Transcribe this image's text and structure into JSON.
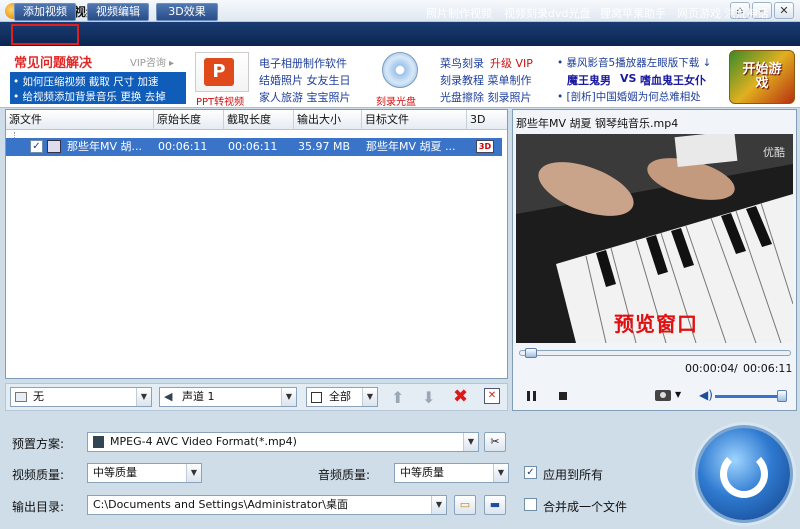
{
  "app": {
    "title": "狸窝全能视频转换器"
  },
  "toolbar": {
    "add_video": "添加视频",
    "edit_video": "视频编辑",
    "effect_3d": "3D效果",
    "links": [
      "照片制作视频",
      "视频刻录dvd光盘",
      "狸窝苹果助手",
      "网页游戏 洪荒神话"
    ]
  },
  "ads": {
    "faq_title": "常见问题解决",
    "vip": "VIP咨询 ▸",
    "faq_items": [
      "• 如何压缩视频  截取  尺寸  加速",
      "• 给视频添加背景音乐  更换  去掉"
    ],
    "ppt_label": "PPT转视频",
    "col1": [
      "电子相册制作软件",
      "结婚照片  女友生日",
      "家人旅游  宝宝照片"
    ],
    "burn_label": "刻录光盘",
    "col2": [
      "菜鸟刻录",
      "升级 VIP",
      "刻录教程  菜单制作",
      "光盘擦除  刻录照片"
    ],
    "col3": [
      "• 暴风影音5播放器左眼版下载 ↓",
      "魔王鬼男",
      "VS",
      "嗜血鬼王女仆",
      "• [剖析]中国婚姻为何总难相处"
    ],
    "game_btn": "开始游戏"
  },
  "file_list": {
    "headers": [
      "源文件",
      "原始长度",
      "截取长度",
      "输出大小",
      "目标文件",
      "3D"
    ],
    "rows": [
      {
        "source": "那些年MV 胡...",
        "orig": "00:06:11",
        "cut": "00:06:11",
        "size": "35.97 MB",
        "target": "那些年MV 胡夏 ..."
      }
    ]
  },
  "list_tools": {
    "subtitle": "无",
    "audio": "声道 1",
    "all": "全部"
  },
  "preview": {
    "title": "那些年MV 胡夏 钢琴纯音乐.mp4",
    "watermark": "预览窗口",
    "youku": "优酷",
    "time_current": "00:00:04",
    "time_separator": "/",
    "time_total": "00:06:11",
    "progress": 0.01
  },
  "settings": {
    "preset_label": "预置方案:",
    "preset_value": "MPEG-4 AVC Video Format(*.mp4)",
    "video_quality_label": "视频质量:",
    "video_quality_value": "中等质量",
    "audio_quality_label": "音频质量:",
    "audio_quality_value": "中等质量",
    "apply_all": "应用到所有",
    "output_label": "输出目录:",
    "output_value": "C:\\Documents and Settings\\Administrator\\桌面",
    "merge": "合并成一个文件"
  },
  "colors": {
    "accent": "#3a74c9",
    "topbar": "#1a3c73",
    "highlight": "#e02020"
  }
}
